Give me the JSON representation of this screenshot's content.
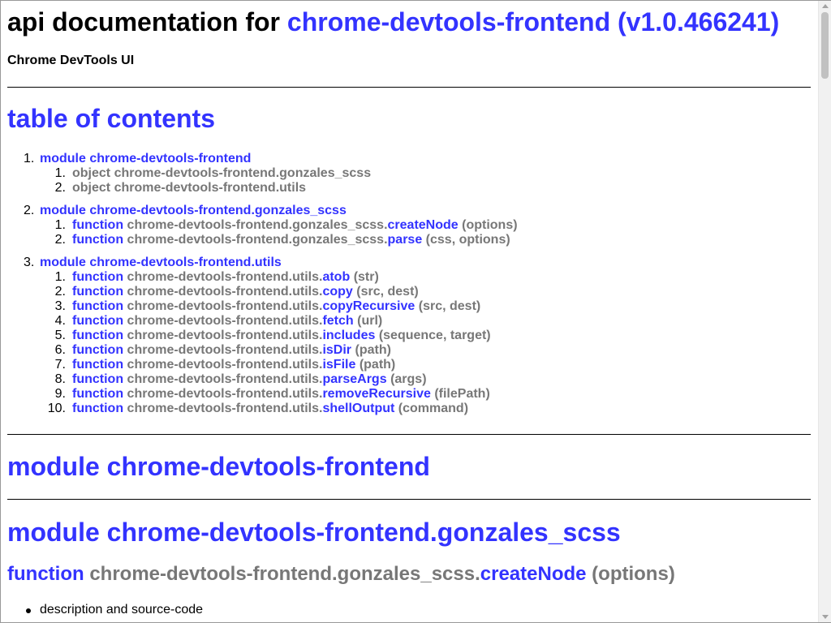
{
  "page": {
    "title_prefix": "api documentation for ",
    "title_link": "chrome-devtools-frontend (v1.0.466241)",
    "subtitle": "Chrome DevTools UI"
  },
  "toc": {
    "heading": "table of contents",
    "modules": [
      {
        "num": "1.",
        "label": "module chrome-devtools-frontend",
        "items": [
          {
            "num": "1.",
            "kind": "object",
            "path": "chrome-devtools-frontend.gonzales_scss",
            "name": "",
            "args": ""
          },
          {
            "num": "2.",
            "kind": "object",
            "path": "chrome-devtools-frontend.utils",
            "name": "",
            "args": ""
          }
        ]
      },
      {
        "num": "2.",
        "label": "module chrome-devtools-frontend.gonzales_scss",
        "items": [
          {
            "num": "1.",
            "kind": "function",
            "path": "chrome-devtools-frontend.gonzales_scss.",
            "name": "createNode",
            "args": "(options)"
          },
          {
            "num": "2.",
            "kind": "function",
            "path": "chrome-devtools-frontend.gonzales_scss.",
            "name": "parse",
            "args": "(css, options)"
          }
        ]
      },
      {
        "num": "3.",
        "label": "module chrome-devtools-frontend.utils",
        "items": [
          {
            "num": "1.",
            "kind": "function",
            "path": "chrome-devtools-frontend.utils.",
            "name": "atob",
            "args": "(str)"
          },
          {
            "num": "2.",
            "kind": "function",
            "path": "chrome-devtools-frontend.utils.",
            "name": "copy",
            "args": "(src, dest)"
          },
          {
            "num": "3.",
            "kind": "function",
            "path": "chrome-devtools-frontend.utils.",
            "name": "copyRecursive",
            "args": "(src, dest)"
          },
          {
            "num": "4.",
            "kind": "function",
            "path": "chrome-devtools-frontend.utils.",
            "name": "fetch",
            "args": "(url)"
          },
          {
            "num": "5.",
            "kind": "function",
            "path": "chrome-devtools-frontend.utils.",
            "name": "includes",
            "args": "(sequence, target)"
          },
          {
            "num": "6.",
            "kind": "function",
            "path": "chrome-devtools-frontend.utils.",
            "name": "isDir",
            "args": "(path)"
          },
          {
            "num": "7.",
            "kind": "function",
            "path": "chrome-devtools-frontend.utils.",
            "name": "isFile",
            "args": "(path)"
          },
          {
            "num": "8.",
            "kind": "function",
            "path": "chrome-devtools-frontend.utils.",
            "name": "parseArgs",
            "args": "(args)"
          },
          {
            "num": "9.",
            "kind": "function",
            "path": "chrome-devtools-frontend.utils.",
            "name": "removeRecursive",
            "args": "(filePath)"
          },
          {
            "num": "10.",
            "kind": "function",
            "path": "chrome-devtools-frontend.utils.",
            "name": "shellOutput",
            "args": "(command)"
          }
        ]
      }
    ]
  },
  "sections": {
    "module1": "module chrome-devtools-frontend",
    "module2": "module chrome-devtools-frontend.gonzales_scss",
    "fn_kind": "function",
    "fn_path": "chrome-devtools-frontend.gonzales_scss.",
    "fn_name": "createNode",
    "fn_args": "(options)",
    "bullet": "description and source-code"
  }
}
